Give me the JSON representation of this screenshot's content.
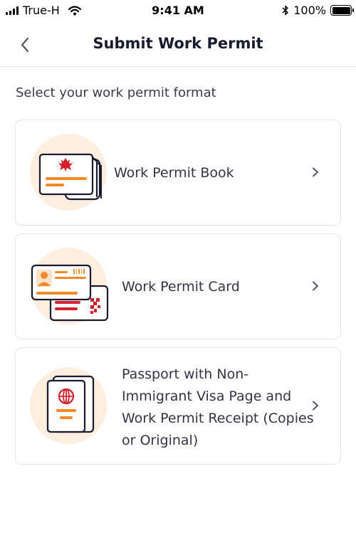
{
  "status_bar": {
    "carrier": "True-H",
    "time": "9:41 AM",
    "battery": "100%"
  },
  "header": {
    "title": "Submit Work Permit"
  },
  "section": {
    "label": "Select your work permit format"
  },
  "options": [
    {
      "label": "Work Permit Book",
      "icon": "work-permit-book-icon"
    },
    {
      "label": "Work Permit Card",
      "icon": "work-permit-card-icon"
    },
    {
      "label": "Passport with Non-Immigrant Visa Page and Work Permit Receipt (Copies or Original)",
      "icon": "passport-icon"
    }
  ],
  "colors": {
    "accent_orange": "#f4892a",
    "accent_red": "#d4202c",
    "illustration_bg": "#fdeee0",
    "outline": "#1a1a2e",
    "card_border": "#e3e3e8"
  }
}
